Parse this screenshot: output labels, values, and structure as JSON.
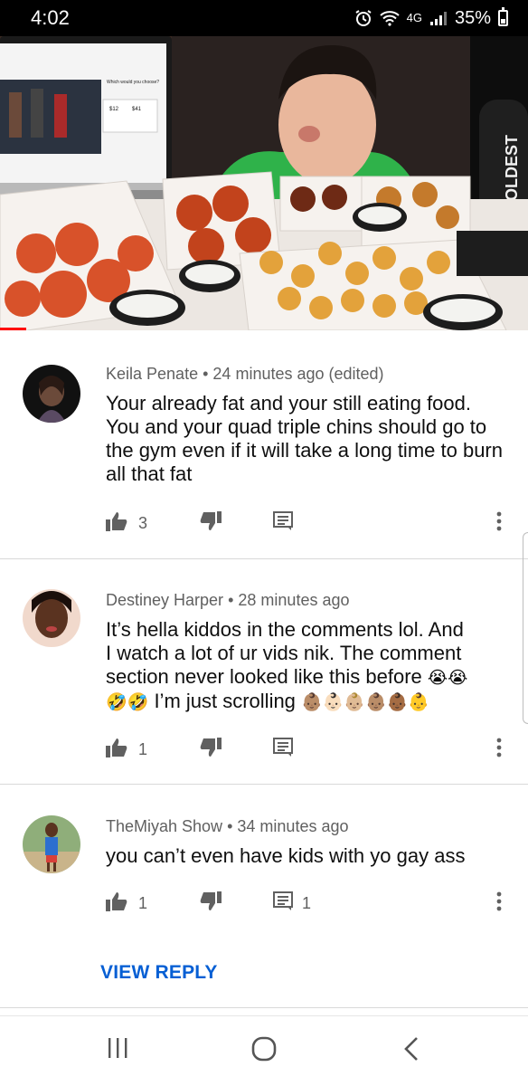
{
  "status_bar": {
    "time": "4:02",
    "network": "4G",
    "battery_percent": "35%",
    "battery_level": 0.35
  },
  "video": {
    "laptop_screen_title": "Which would you choose?",
    "price_left": "$12",
    "price_right": "$41",
    "bottle_text": "COLDEST",
    "progress_fraction": 0.05,
    "accent_color": "#ff0000"
  },
  "comments": [
    {
      "author": "Keila Penate",
      "time": "24 minutes ago (edited)",
      "text": "Your already fat and your still eating food. You and your quad triple chins should go to the gym even if it will take a long time to burn all that fat",
      "likes": "3",
      "replies": ""
    },
    {
      "author": "Destiney Harper",
      "time": "28 minutes ago",
      "text_line1": "It’s hella kiddos in the comments lol. And",
      "text_line2": "I watch a lot of ur vids nik. The comment",
      "text_line3": "section never looked like this before",
      "emoji_line3": "😭😭",
      "emoji_line4a": "🤣🤣",
      "text_line4": " I’m just scrolling ",
      "emoji_line4b": "👶🏽👶🏻👶🏼👶🏽👶🏾👶",
      "likes": "1",
      "replies": ""
    },
    {
      "author": "TheMiyah Show",
      "time": "34 minutes ago",
      "text": "you can’t even have kids with yo gay ass",
      "likes": "1",
      "replies": "1"
    }
  ],
  "view_reply_label": "VIEW REPLY",
  "separator": "•",
  "colors": {
    "link_blue": "#065fd4",
    "meta_gray": "#606060",
    "divider": "#d9d9d9"
  }
}
